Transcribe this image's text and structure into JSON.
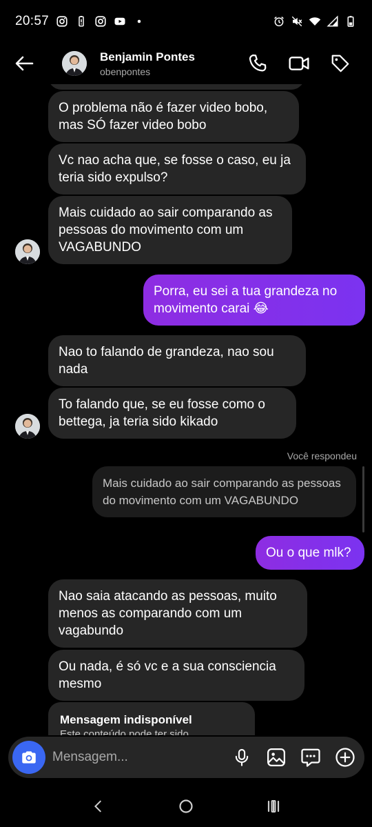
{
  "status": {
    "time": "20:57"
  },
  "header": {
    "name": "Benjamin Pontes",
    "username": "obenpontes"
  },
  "messages": {
    "m1": "O problema não é fazer video bobo, mas SÓ fazer video bobo",
    "m2": "Vc nao acha que, se fosse o caso, eu ja teria sido expulso?",
    "m3": "Mais cuidado ao sair comparando as pessoas do movimento com um VAGABUNDO",
    "m4": "Porra, eu sei a tua grandeza no movimento carai 😂",
    "m5": "Nao to falando de grandeza, nao sou nada",
    "m6": "To falando que, se eu fosse como o bettega, ja teria sido kikado",
    "reply_label": "Você respondeu",
    "reply_quote": "Mais cuidado ao sair comparando as pessoas do movimento com um VAGABUNDO",
    "m7": "Ou o que mlk?",
    "m8": "Nao saia atacando as pessoas, muito menos as comparando com um vagabundo",
    "m9": "Ou nada, é só vc e a sua consciencia mesmo",
    "unavailable_title": "Mensagem indisponível",
    "unavailable_sub": "Este conteúdo pode ter sido"
  },
  "composer": {
    "placeholder": "Mensagem..."
  },
  "colors": {
    "sent_bubble": "#8e2de2",
    "received_bubble": "#262626",
    "camera_button": "#3a67f2"
  },
  "icons": {
    "status_left": [
      "instagram-icon",
      "battery-saver-icon",
      "instagram-icon",
      "youtube-icon",
      "dot-icon"
    ],
    "status_right": [
      "alarm-icon",
      "mute-icon",
      "wifi-icon",
      "signal-icon",
      "battery-icon"
    ],
    "header": [
      "back-arrow-icon",
      "phone-icon",
      "video-camera-icon",
      "tag-icon"
    ],
    "composer": [
      "camera-icon",
      "microphone-icon",
      "gallery-icon",
      "sticker-chat-icon",
      "plus-circle-icon"
    ],
    "nav": [
      "back-icon",
      "home-icon",
      "recents-icon"
    ]
  }
}
